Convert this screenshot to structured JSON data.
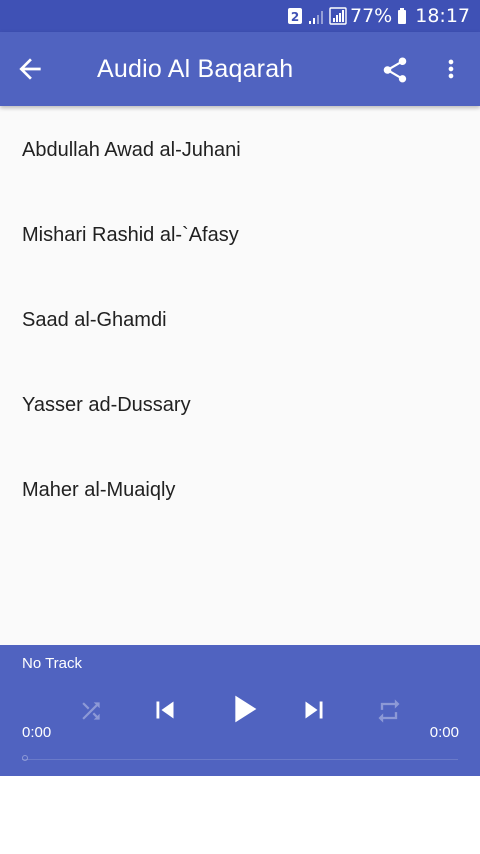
{
  "status_bar": {
    "sim_badge": "2",
    "battery_percent": "77%",
    "time": "18:17",
    "icons": [
      "sim-2-icon",
      "signal-weak-icon",
      "signal-icon",
      "battery-icon"
    ]
  },
  "app_bar": {
    "title": "Audio Al Baqarah",
    "background": "#5063c0",
    "icons": [
      "back-arrow-icon",
      "share-icon",
      "more-vert-icon"
    ]
  },
  "reciters": [
    {
      "label": "Abdullah Awad al-Juhani"
    },
    {
      "label": "Mishari Rashid al-`Afasy"
    },
    {
      "label": "Saad al-Ghamdi"
    },
    {
      "label": "Yasser ad-Dussary"
    },
    {
      "label": "Maher al-Muaiqly"
    }
  ],
  "player": {
    "track_name": "No Track",
    "current_time": "0:00",
    "total_time": "0:00",
    "progress": 0,
    "icons": [
      "shuffle-icon",
      "skip-previous-icon",
      "play-icon",
      "skip-next-icon",
      "repeat-icon"
    ]
  },
  "colors": {
    "status_bar": "#3f51b5",
    "primary": "#5063c0",
    "background": "#fafafa",
    "text": "#212121"
  }
}
